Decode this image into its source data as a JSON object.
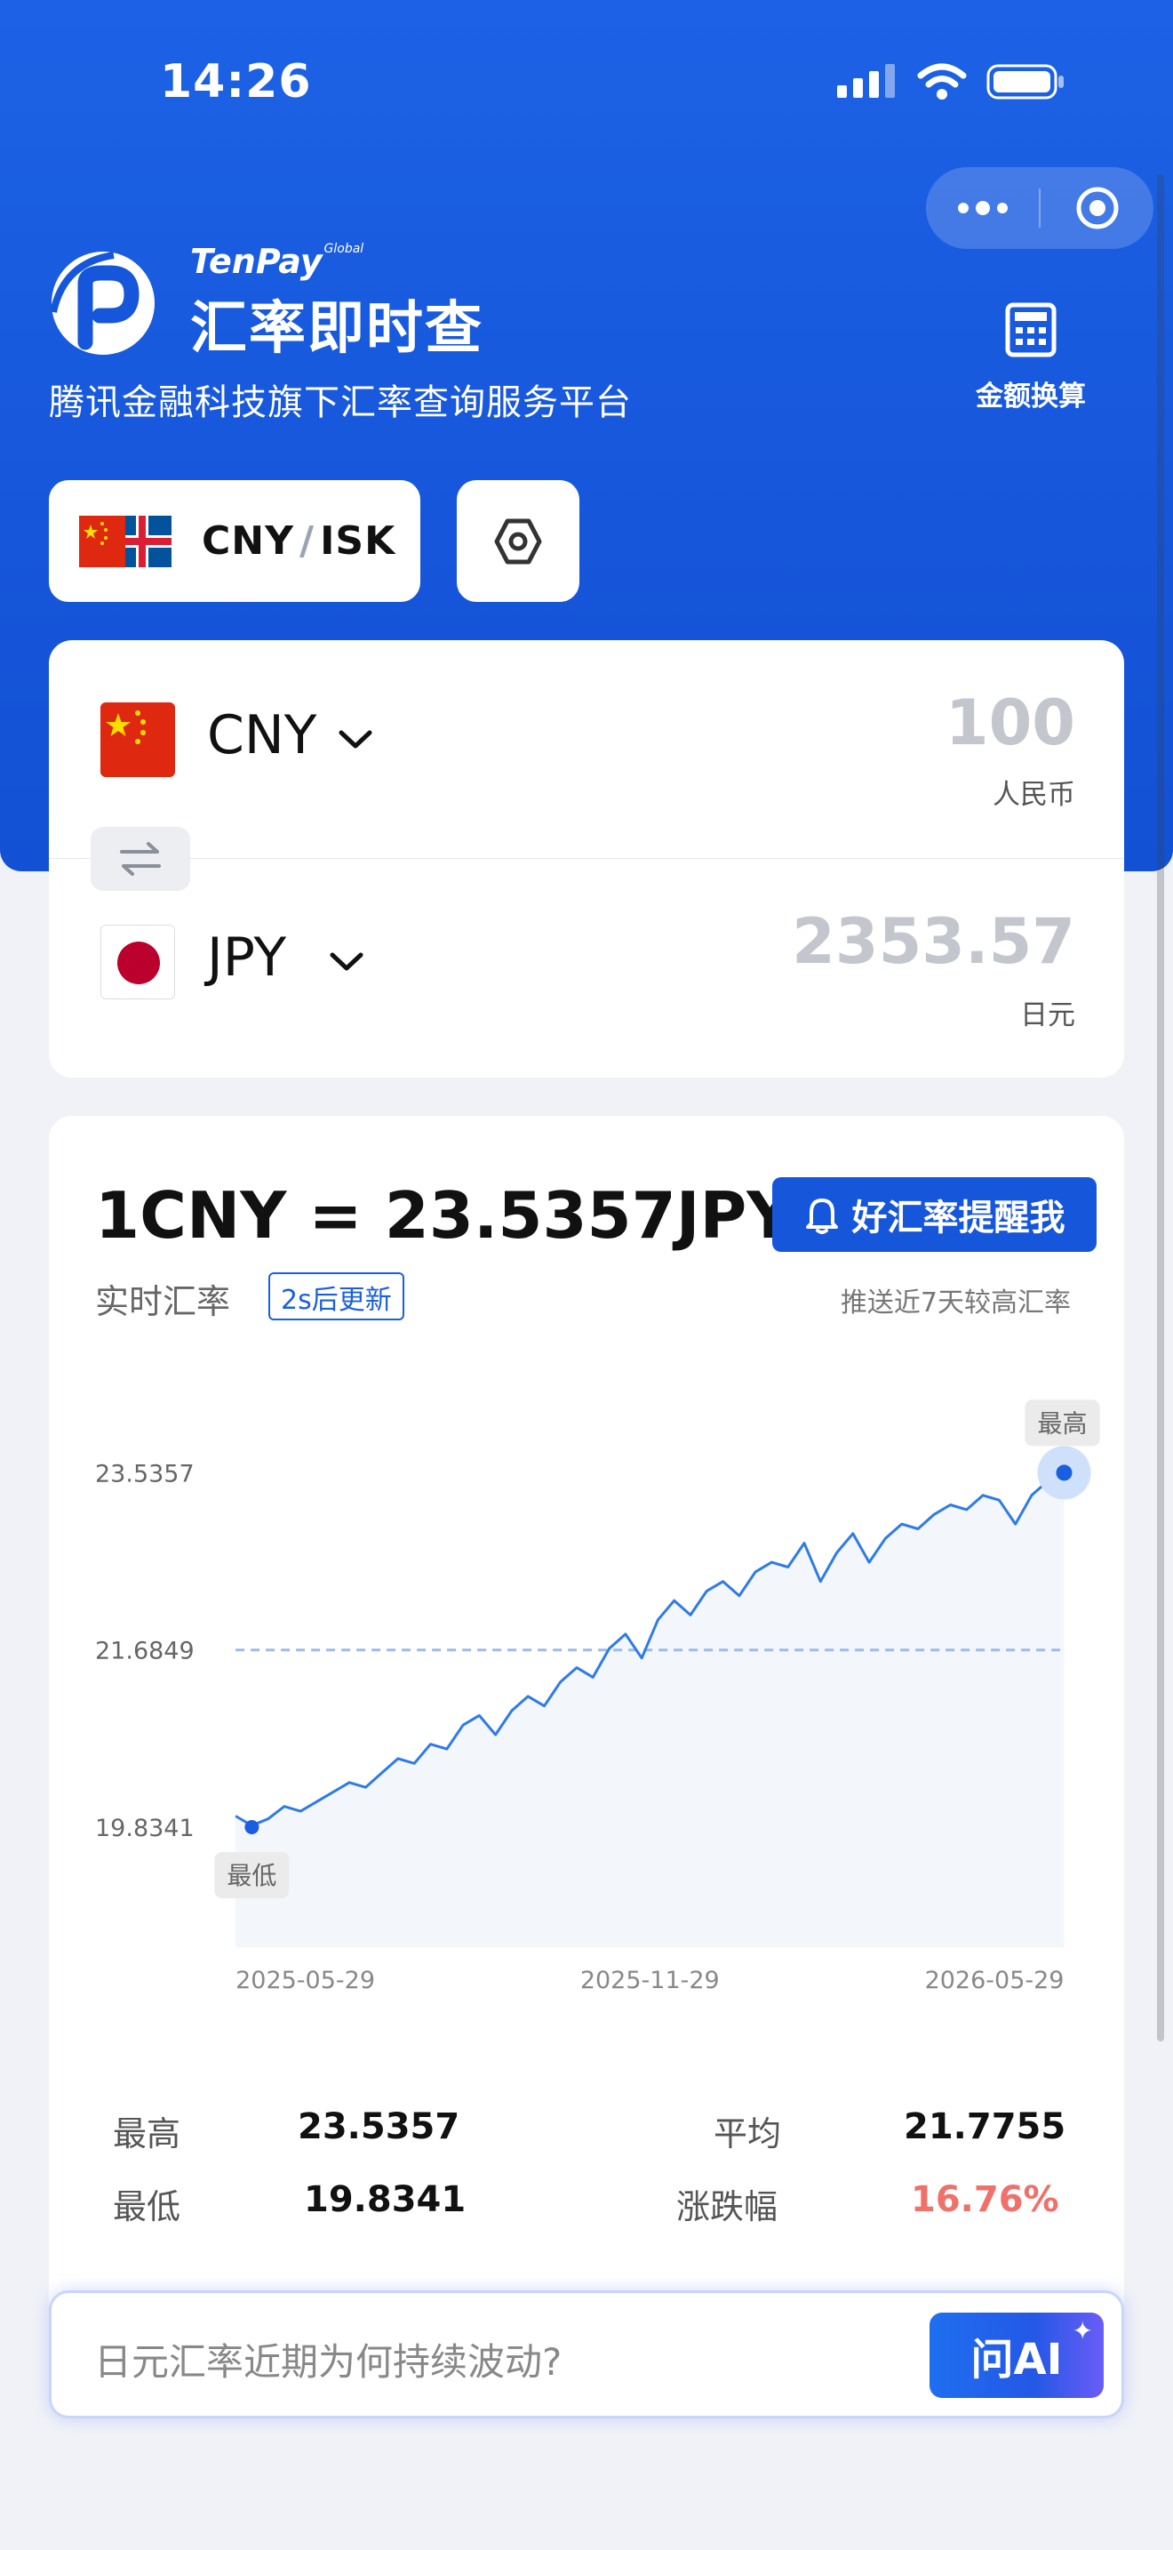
{
  "status_bar": {
    "time": "14:26"
  },
  "header": {
    "brand_name": "TenPay",
    "brand_super": "Global",
    "app_title": "汇率即时查",
    "subtitle": "腾讯金融科技旗下汇率查询服务平台",
    "calculator_label": "金额换算"
  },
  "pair_selector": {
    "base": "CNY",
    "quote": "ISK"
  },
  "converter": {
    "from": {
      "code": "CNY",
      "amount": "100",
      "unit": "人民币"
    },
    "to": {
      "code": "JPY",
      "amount": "2353.57",
      "unit": "日元"
    }
  },
  "rate_card": {
    "headline": "1CNY = 23.5357JPY",
    "realtime_label": "实时汇率",
    "update_badge": "2s后更新",
    "alert_button": "好汇率提醒我",
    "alert_note": "推送近7天较高汇率"
  },
  "chart_data": {
    "type": "line",
    "series": [
      {
        "values": [
          19.95,
          19.85,
          19.92,
          20.05,
          20.0,
          20.1,
          20.2,
          20.3,
          20.25,
          20.4,
          20.55,
          20.5,
          20.7,
          20.65,
          20.9,
          21.0,
          20.8,
          21.05,
          21.2,
          21.1,
          21.35,
          21.5,
          21.4,
          21.7,
          21.85,
          21.6,
          22.0,
          22.2,
          22.05,
          22.3,
          22.4,
          22.25,
          22.5,
          22.6,
          22.55,
          22.8,
          22.4,
          22.7,
          22.9,
          22.6,
          22.85,
          23.0,
          22.95,
          23.1,
          23.2,
          23.15,
          23.3,
          23.25,
          23.0,
          23.3,
          23.45,
          23.5357
        ]
      }
    ],
    "x_ticks": [
      "2025-05-29",
      "2025-11-29",
      "2026-05-29"
    ],
    "y_ticks": [
      "23.5357",
      "21.6849",
      "19.8341"
    ],
    "ylim": [
      19.8341,
      23.5357
    ],
    "average_line": 21.6849,
    "max_label": "最高",
    "min_label": "最低",
    "colors": {
      "line": "#2f7be5",
      "marker": "#1a5fe0",
      "dashed": "#9bbcec"
    }
  },
  "stats": {
    "high_label": "最高",
    "high_value": "23.5357",
    "avg_label": "平均",
    "avg_value": "21.7755",
    "low_label": "最低",
    "low_value": "19.8341",
    "change_label": "涨跌幅",
    "change_value": "16.76%",
    "change_color": "#f0706a"
  },
  "ask_bar": {
    "placeholder": "日元汇率近期为何持续波动?",
    "button": "问AI"
  }
}
